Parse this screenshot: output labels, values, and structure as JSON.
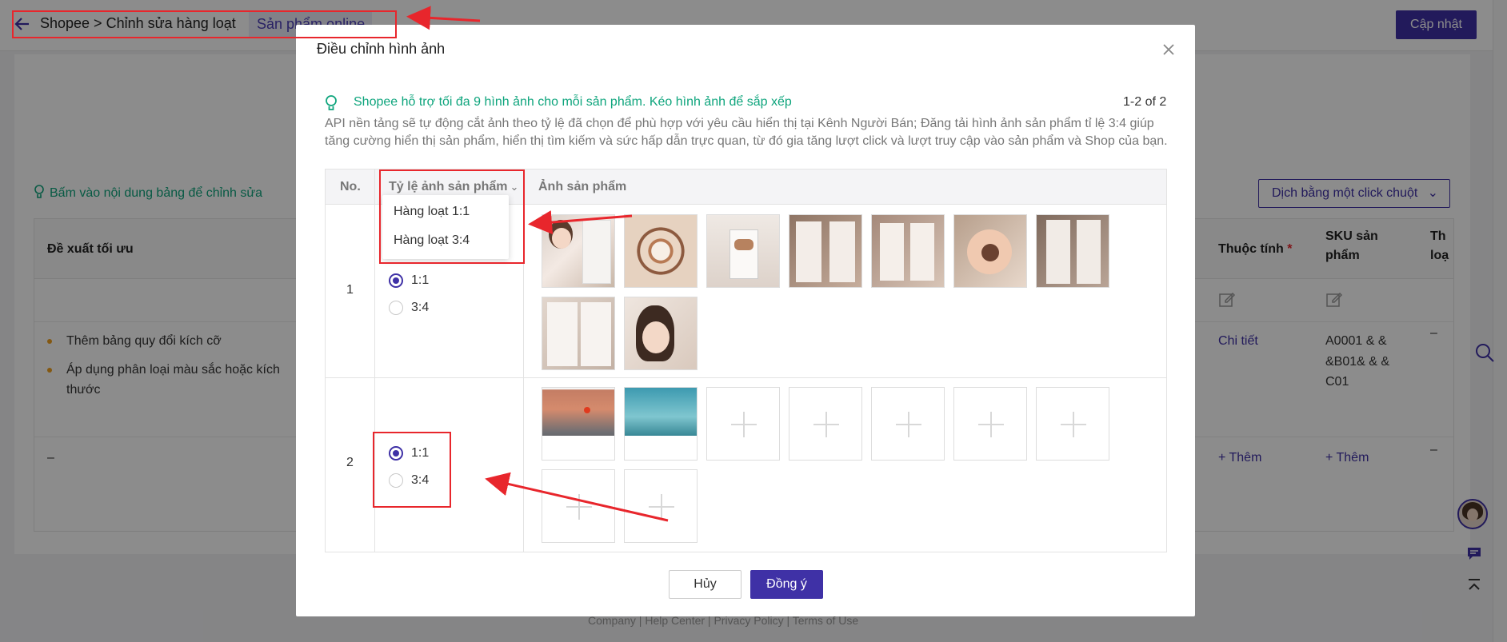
{
  "page": {
    "breadcrumb": "Shopee > Chỉnh sửa hàng loạt",
    "online_tab": "Sản phẩm online",
    "update_button": "Cập nhật",
    "hint": "Bấm vào nội dung bảng để chỉnh sửa",
    "translate_button": "Dịch bằng một click chuột",
    "columns": {
      "suggest": "Đề xuất tối ưu",
      "attributes": "Thuộc tính",
      "attributes_required": "*",
      "sku_line1": "SKU sản",
      "sku_line2": "phẩm",
      "cut_line1": "Th",
      "cut_line2": "loạ"
    },
    "rows": [
      {
        "suggestions": [
          "Thêm bảng quy đổi kích cỡ",
          "Áp dụng phân loại màu sắc hoặc kích thước"
        ],
        "attribute": "Chi tiết",
        "sku_lines": [
          "A0001 & &",
          "&B01& & &",
          "C01"
        ],
        "cut": "–"
      },
      {
        "suggestions_dash": "–",
        "attribute": "+ Thêm",
        "sku": "+ Thêm",
        "cut": "–"
      }
    ],
    "footer": "Company  |  Help Center  |  Privacy Policy  |  Terms of Use"
  },
  "modal": {
    "title": "Điều chỉnh hình ảnh",
    "tip": "Shopee hỗ trợ tối đa 9 hình ảnh cho mỗi sản phẩm. Kéo hình ảnh để sắp xếp",
    "pager": "1-2 of 2",
    "description": "API nền tảng sẽ tự động cắt ảnh theo tỷ lệ đã chọn để phù hợp với yêu cầu hiển thị tại Kênh Người Bán; Đăng tải hình ảnh sản phẩm tỉ lệ 3:4 giúp tăng cường hiển thị sản phẩm, hiển thị tìm kiếm và sức hấp dẫn trực quan, từ đó gia tăng lượt click và lượt truy cập vào sản phẩm và Shop của bạn.",
    "table_headers": {
      "no": "No.",
      "ratio": "Tỷ lệ ảnh sản phẩm",
      "images": "Ảnh sản phẩm"
    },
    "ratio_menu": [
      "Hàng loạt 1:1",
      "Hàng loạt 3:4"
    ],
    "rows": [
      {
        "no": "1",
        "options": [
          "1:1",
          "3:4"
        ],
        "selected": "1:1",
        "image_count": 9
      },
      {
        "no": "2",
        "options": [
          "1:1",
          "3:4"
        ],
        "selected": "1:1",
        "image_count": 2
      }
    ],
    "cancel": "Hủy",
    "confirm": "Đồng ý"
  },
  "colors": {
    "brand": "#3f31a6",
    "tip_green": "#0fa57d",
    "annotation_red": "#e8262c"
  }
}
